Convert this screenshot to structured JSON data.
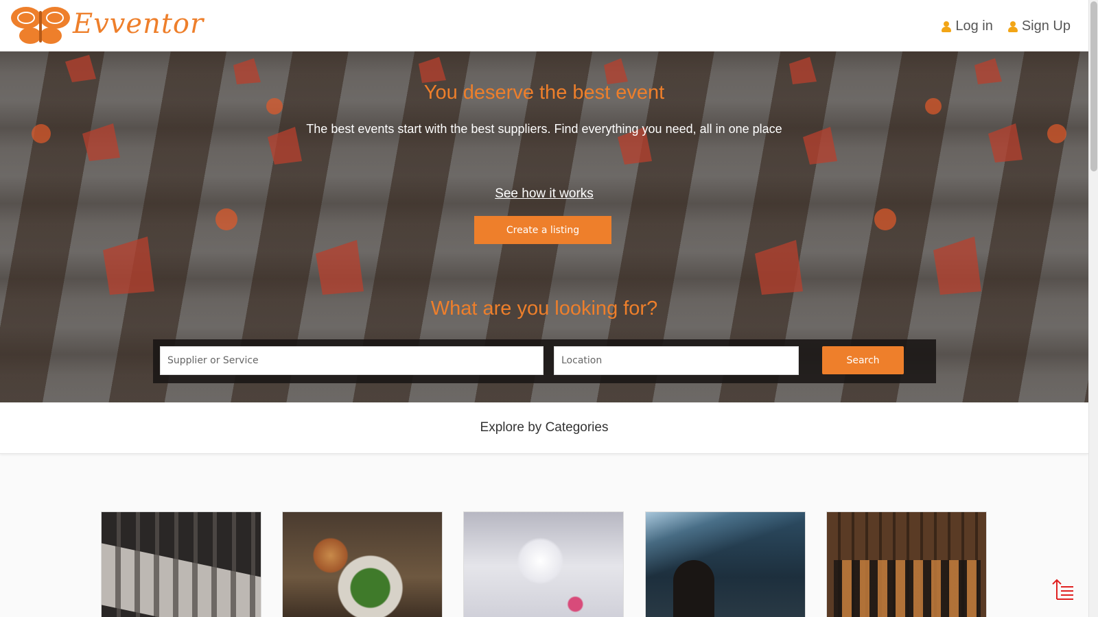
{
  "header": {
    "brand": "Evventor",
    "nav": {
      "login_label": "Log in",
      "signup_label": "Sign Up"
    }
  },
  "hero": {
    "title": "You deserve the best event",
    "subtitle": "The best events start with the best suppliers. Find everything you need, all in one place",
    "how_link": "See how it works",
    "create_button": "Create a listing",
    "looking_title": "What are you looking for?",
    "search": {
      "service_placeholder": "Supplier or Service",
      "location_placeholder": "Location",
      "button_label": "Search"
    }
  },
  "categories": {
    "title": "Explore by Categories"
  },
  "colors": {
    "accent": "#ee7f2b",
    "user_icon": "#f2a516",
    "scroll_top_icon": "#e02020"
  },
  "icons": [
    "butterfly-logo-icon",
    "user-icon",
    "scroll-to-top-icon"
  ]
}
